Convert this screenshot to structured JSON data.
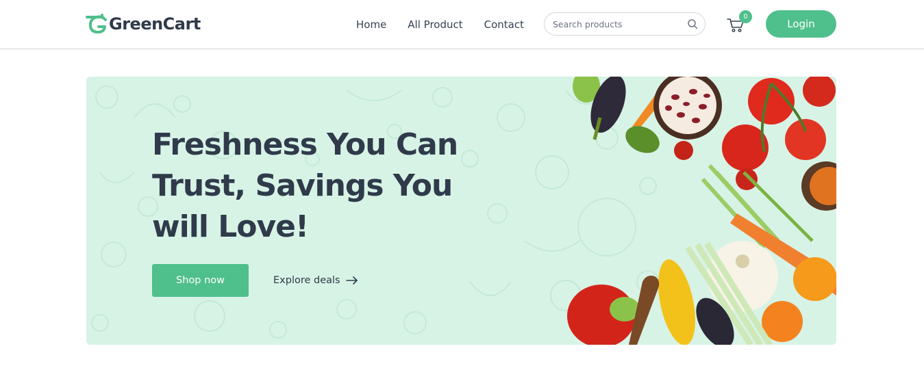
{
  "brand": {
    "name": "GreenCart",
    "accent_color": "#4fbf8b",
    "text_color": "#2f3a4a"
  },
  "nav": {
    "links": [
      "Home",
      "All Product",
      "Contact"
    ]
  },
  "search": {
    "placeholder": "Search products",
    "value": "",
    "icon": "search-icon"
  },
  "cart": {
    "icon": "cart-icon",
    "count": "0"
  },
  "login": {
    "label": "Login"
  },
  "hero": {
    "background_color": "#d7f3e6",
    "title": "Freshness You Can Trust, Savings You will Love!",
    "primary_cta": "Shop now",
    "secondary_cta": "Explore deals",
    "secondary_icon": "arrow-right-icon",
    "image": "fresh-vegetables-illustration"
  }
}
